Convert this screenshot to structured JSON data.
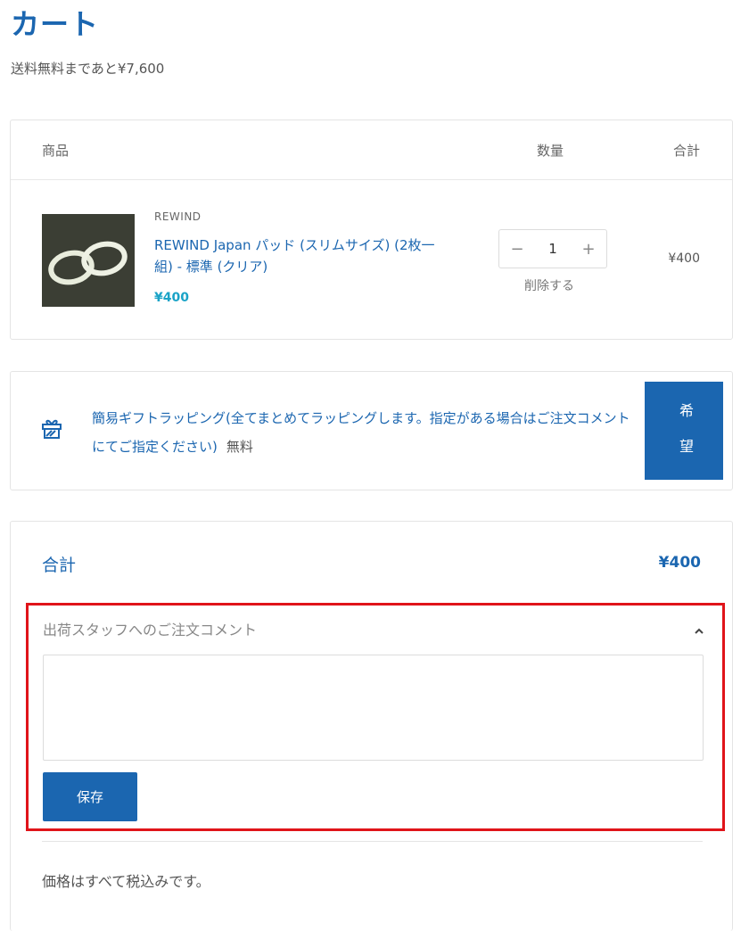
{
  "page": {
    "title": "カート",
    "free_shipping_notice": "送料無料まであと¥7,600"
  },
  "cart_table": {
    "headers": {
      "product": "商品",
      "quantity": "数量",
      "total": "合計"
    },
    "items": [
      {
        "vendor": "REWIND",
        "title": "REWIND Japan パッド (スリムサイズ) (2枚一組) - 標準 (クリア)",
        "price": "¥400",
        "quantity": "1",
        "decrement_symbol": "−",
        "increment_symbol": "+",
        "remove_label": "削除する",
        "line_total": "¥400"
      }
    ]
  },
  "gift_wrap": {
    "icon": "gift-icon",
    "description": "簡易ギフトラッピング(全てまとめてラッピングします。指定がある場合はご注文コメントにてご指定ください)",
    "price_label": "無料",
    "button_label": "希望"
  },
  "summary": {
    "total_label": "合計",
    "total_value": "¥400",
    "comment_section": {
      "label": "出荷スタッフへのご注文コメント",
      "textarea_value": "",
      "save_label": "保存"
    },
    "tax_note": "価格はすべて税込みです。"
  },
  "colors": {
    "brand_blue": "#1b66b0",
    "price_teal": "#1aa3c7",
    "highlight_red": "#e0141a"
  }
}
